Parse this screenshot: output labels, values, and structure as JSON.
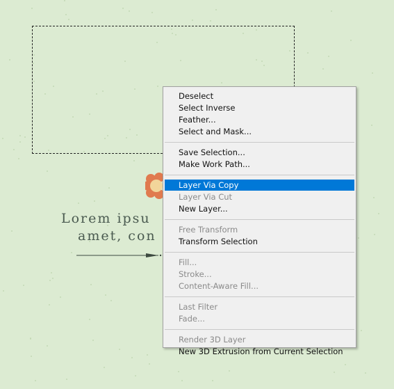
{
  "canvas": {
    "lorem_line1": "Lorem ipsu",
    "lorem_line2": "amet, con"
  },
  "context_menu": {
    "groups": [
      [
        {
          "label": "Deselect",
          "enabled": true
        },
        {
          "label": "Select Inverse",
          "enabled": true
        },
        {
          "label": "Feather...",
          "enabled": true
        },
        {
          "label": "Select and Mask...",
          "enabled": true
        }
      ],
      [
        {
          "label": "Save Selection...",
          "enabled": true
        },
        {
          "label": "Make Work Path...",
          "enabled": true
        }
      ],
      [
        {
          "label": "Layer Via Copy",
          "enabled": true,
          "highlighted": true
        },
        {
          "label": "Layer Via Cut",
          "enabled": false
        },
        {
          "label": "New Layer...",
          "enabled": true
        }
      ],
      [
        {
          "label": "Free Transform",
          "enabled": false
        },
        {
          "label": "Transform Selection",
          "enabled": true
        }
      ],
      [
        {
          "label": "Fill...",
          "enabled": false
        },
        {
          "label": "Stroke...",
          "enabled": false
        },
        {
          "label": "Content-Aware Fill...",
          "enabled": false
        }
      ],
      [
        {
          "label": "Last Filter",
          "enabled": false
        },
        {
          "label": "Fade...",
          "enabled": false
        }
      ],
      [
        {
          "label": "Render 3D Layer",
          "enabled": false
        },
        {
          "label": "New 3D Extrusion from Current Selection",
          "enabled": true
        }
      ]
    ]
  },
  "colors": {
    "highlight": "#0078d7",
    "background": "#dcebd2",
    "disabled_text": "#8a8a8a"
  }
}
